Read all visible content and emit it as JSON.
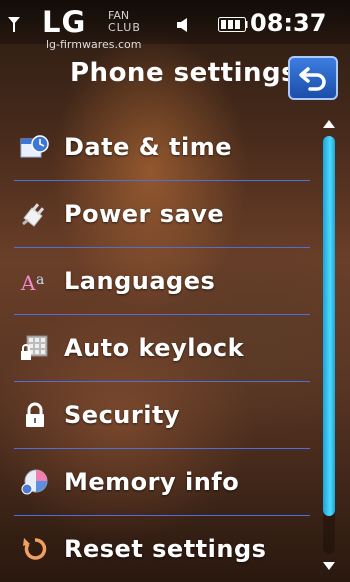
{
  "status_bar": {
    "brand": "LG",
    "brand_fan": "FAN",
    "brand_club": "CLUB",
    "watermark": "lg-firmwares.com",
    "time": "08:37"
  },
  "header": {
    "title": "Phone settings"
  },
  "menu": {
    "items": [
      {
        "label": "Date & time",
        "icon": "calendar-clock-icon"
      },
      {
        "label": "Power save",
        "icon": "power-plug-icon"
      },
      {
        "label": "Languages",
        "icon": "language-icon"
      },
      {
        "label": "Auto keylock",
        "icon": "keypad-lock-icon"
      },
      {
        "label": "Security",
        "icon": "padlock-icon"
      },
      {
        "label": "Memory info",
        "icon": "memory-pie-icon"
      },
      {
        "label": "Reset settings",
        "icon": "reset-arrow-icon"
      }
    ]
  },
  "scroll": {
    "position_fraction": 0.0,
    "visible_fraction": 0.91
  },
  "colors": {
    "accent_blue": "#1b4ea8",
    "divider": "#4f6fd8",
    "scroll_thumb": "#4fd8ff"
  }
}
